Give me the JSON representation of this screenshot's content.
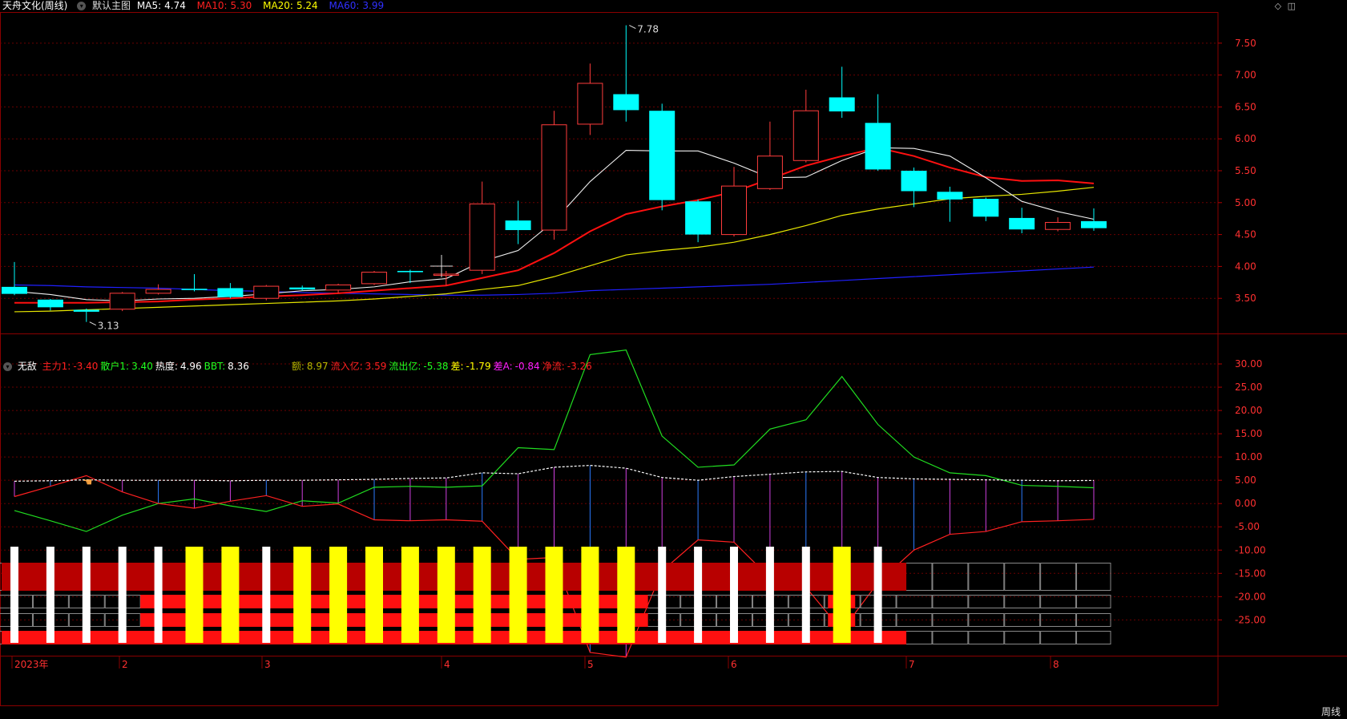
{
  "header": {
    "stock_name": "天舟文化(周线)",
    "main_chart_label": "默认主图",
    "indicators": [
      {
        "label": "MA5:",
        "value": "4.74",
        "color": "#ffffff"
      },
      {
        "label": "MA10:",
        "value": "5.30",
        "color": "#ff2020"
      },
      {
        "label": "MA20:",
        "value": "5.24",
        "color": "#ffff00"
      },
      {
        "label": "MA60:",
        "value": "3.99",
        "color": "#3030ff"
      }
    ]
  },
  "corner_icons": [
    "diamond-icon",
    "panel-icon"
  ],
  "sub_header": {
    "name": "无敌",
    "indicators": [
      {
        "label": "主力1:",
        "value": "-3.40",
        "color": "#ff2020"
      },
      {
        "label": "散户1:",
        "value": "3.40",
        "color": "#20ff20"
      },
      {
        "label": "热度:",
        "value": "4.96",
        "color": "#ffffff"
      },
      {
        "label": "BBT:",
        "value": "8.36",
        "color": "#20ff20"
      },
      {
        "label": "额:",
        "value": "8.97",
        "color": "#b8b800",
        "gap": true
      },
      {
        "label": "流入亿:",
        "value": "3.59",
        "color": "#ff2020"
      },
      {
        "label": "流出亿:",
        "value": "-5.38",
        "color": "#20ff20"
      },
      {
        "label": "差:",
        "value": "-1.79",
        "color": "#ffff00"
      },
      {
        "label": "差A:",
        "value": "-0.84",
        "color": "#ff20ff"
      },
      {
        "label": "净流:",
        "value": "-3.26",
        "color": "#ff2020"
      }
    ]
  },
  "x_axis_labels": [
    "2023年",
    "2",
    "3",
    "4",
    "5",
    "6",
    "7",
    "8"
  ],
  "period_label": "周线",
  "chart_data": [
    {
      "type": "candlestick",
      "title": "天舟文化(周线)",
      "y_ticks": [
        "7.50",
        "7.00",
        "6.50",
        "6.00",
        "5.50",
        "5.00",
        "4.50",
        "4.00",
        "3.50"
      ],
      "ylim": [
        3.0,
        7.95
      ],
      "annotations": [
        {
          "text": "7.78",
          "value": 7.78,
          "index": 17
        },
        {
          "text": "3.13",
          "value": 3.13,
          "index": 2
        }
      ],
      "candles": [
        {
          "o": 3.68,
          "c": 3.57,
          "h": 4.07,
          "l": 3.55
        },
        {
          "o": 3.48,
          "c": 3.36,
          "h": 3.49,
          "l": 3.31
        },
        {
          "o": 3.32,
          "c": 3.29,
          "h": 3.34,
          "l": 3.13
        },
        {
          "o": 3.33,
          "c": 3.58,
          "h": 3.6,
          "l": 3.3
        },
        {
          "o": 3.58,
          "c": 3.64,
          "h": 3.72,
          "l": 3.56
        },
        {
          "o": 3.65,
          "c": 3.63,
          "h": 3.88,
          "l": 3.61
        },
        {
          "o": 3.66,
          "c": 3.52,
          "h": 3.74,
          "l": 3.5
        },
        {
          "o": 3.5,
          "c": 3.69,
          "h": 3.71,
          "l": 3.47
        },
        {
          "o": 3.67,
          "c": 3.64,
          "h": 3.7,
          "l": 3.62
        },
        {
          "o": 3.63,
          "c": 3.71,
          "h": 3.73,
          "l": 3.58
        },
        {
          "o": 3.73,
          "c": 3.91,
          "h": 3.93,
          "l": 3.71
        },
        {
          "o": 3.93,
          "c": 3.91,
          "h": 3.95,
          "l": 3.74
        },
        {
          "o": 3.87,
          "c": 3.88,
          "h": 3.93,
          "l": 3.7
        },
        {
          "o": 3.94,
          "c": 4.98,
          "h": 5.33,
          "l": 3.88
        },
        {
          "o": 4.72,
          "c": 4.57,
          "h": 5.03,
          "l": 4.35
        },
        {
          "o": 4.57,
          "c": 6.22,
          "h": 6.44,
          "l": 4.42
        },
        {
          "o": 6.23,
          "c": 6.87,
          "h": 7.18,
          "l": 6.06
        },
        {
          "o": 6.7,
          "c": 6.45,
          "h": 7.78,
          "l": 6.27
        },
        {
          "o": 6.44,
          "c": 5.04,
          "h": 6.55,
          "l": 4.88
        },
        {
          "o": 5.02,
          "c": 4.5,
          "h": 5.05,
          "l": 4.38
        },
        {
          "o": 4.5,
          "c": 5.26,
          "h": 5.56,
          "l": 4.47
        },
        {
          "o": 5.22,
          "c": 5.73,
          "h": 6.27,
          "l": 5.2
        },
        {
          "o": 5.66,
          "c": 6.44,
          "h": 6.77,
          "l": 5.63
        },
        {
          "o": 6.65,
          "c": 6.43,
          "h": 7.13,
          "l": 6.33
        },
        {
          "o": 6.25,
          "c": 5.52,
          "h": 6.7,
          "l": 5.5
        },
        {
          "o": 5.5,
          "c": 5.18,
          "h": 5.55,
          "l": 4.93
        },
        {
          "o": 5.17,
          "c": 5.05,
          "h": 5.25,
          "l": 4.7
        },
        {
          "o": 5.06,
          "c": 4.78,
          "h": 5.08,
          "l": 4.71
        },
        {
          "o": 4.76,
          "c": 4.58,
          "h": 4.92,
          "l": 4.52
        },
        {
          "o": 4.58,
          "c": 4.69,
          "h": 4.77,
          "l": 4.55
        },
        {
          "o": 4.71,
          "c": 4.6,
          "h": 4.91,
          "l": 4.56
        }
      ],
      "ma5": [
        3.61,
        3.56,
        3.48,
        3.46,
        3.49,
        3.5,
        3.53,
        3.57,
        3.62,
        3.64,
        3.68,
        3.76,
        3.81,
        4.08,
        4.25,
        4.71,
        5.33,
        5.82,
        5.81,
        5.81,
        5.62,
        5.39,
        5.4,
        5.66,
        5.86,
        5.85,
        5.73,
        5.39,
        5.02,
        4.86,
        4.74
      ],
      "ma10": [
        3.43,
        3.43,
        3.43,
        3.44,
        3.45,
        3.48,
        3.5,
        3.53,
        3.55,
        3.58,
        3.62,
        3.66,
        3.7,
        3.82,
        3.94,
        4.21,
        4.55,
        4.82,
        4.94,
        5.04,
        5.17,
        5.37,
        5.58,
        5.73,
        5.86,
        5.73,
        5.55,
        5.4,
        5.34,
        5.35,
        5.3
      ],
      "ma20": [
        3.29,
        3.3,
        3.32,
        3.34,
        3.36,
        3.38,
        3.4,
        3.42,
        3.44,
        3.46,
        3.49,
        3.53,
        3.57,
        3.64,
        3.7,
        3.84,
        4.01,
        4.18,
        4.25,
        4.3,
        4.38,
        4.5,
        4.64,
        4.8,
        4.9,
        4.98,
        5.06,
        5.1,
        5.13,
        5.18,
        5.24
      ],
      "ma60": [
        3.71,
        3.7,
        3.68,
        3.67,
        3.66,
        3.64,
        3.62,
        3.61,
        3.59,
        3.58,
        3.57,
        3.56,
        3.55,
        3.55,
        3.56,
        3.58,
        3.62,
        3.64,
        3.66,
        3.68,
        3.7,
        3.72,
        3.75,
        3.78,
        3.81,
        3.84,
        3.87,
        3.9,
        3.93,
        3.96,
        3.99
      ]
    },
    {
      "type": "line",
      "title": "无敌",
      "y_ticks": [
        "30.00",
        "25.00",
        "20.00",
        "15.00",
        "10.00",
        "5.00",
        "0.00",
        "-5.00",
        "-10.00",
        "-15.00",
        "-20.00",
        "-25.00"
      ],
      "ylim": [
        -32.0,
        35.0
      ],
      "series": [
        {
          "name": "散户1",
          "color": "#20dd20",
          "values": [
            -1.5,
            -3.7,
            -6.0,
            -2.5,
            0.0,
            1.0,
            -0.5,
            -1.7,
            0.6,
            0.1,
            3.5,
            3.7,
            3.5,
            3.8,
            12.0,
            11.6,
            32.0,
            33.0,
            14.5,
            7.8,
            8.3,
            16.0,
            18.0,
            27.3,
            17.0,
            10.0,
            6.6,
            6.0,
            3.9,
            3.7,
            3.4
          ]
        },
        {
          "name": "主力1",
          "color": "#ff2020",
          "values": [
            1.5,
            3.7,
            6.0,
            2.5,
            0.0,
            -1.0,
            0.5,
            1.7,
            -0.6,
            -0.1,
            -3.5,
            -3.7,
            -3.5,
            -3.8,
            -12.0,
            -11.6,
            -32.0,
            -33.0,
            -14.5,
            -7.8,
            -8.3,
            -16.0,
            -18.0,
            -27.3,
            -17.0,
            -10.0,
            -6.6,
            -6.0,
            -3.9,
            -3.7,
            -3.4
          ]
        },
        {
          "name": "热度",
          "color": "#ffffff",
          "dashed": true,
          "values": [
            4.8,
            4.9,
            5.1,
            5.0,
            5.0,
            5.0,
            4.9,
            5.0,
            5.0,
            5.1,
            5.2,
            5.4,
            5.5,
            6.6,
            6.4,
            7.8,
            8.2,
            7.6,
            5.6,
            5.0,
            5.8,
            6.3,
            6.8,
            6.9,
            5.6,
            5.3,
            5.2,
            5.1,
            5.0,
            4.9,
            4.96
          ]
        }
      ],
      "signal_columns": [
        "white",
        "white",
        "white",
        "white",
        "white",
        "yellow",
        "yellow",
        "white",
        "yellow",
        "yellow",
        "yellow",
        "yellow",
        "yellow",
        "yellow",
        "yellow",
        "yellow",
        "yellow",
        "yellow",
        "white",
        "white",
        "white",
        "white",
        "white",
        "yellow",
        "white"
      ],
      "band_rows": [
        {
          "color": "#b80000",
          "start": 0,
          "end": 25
        },
        {
          "color": "#ff1010",
          "start": 4,
          "end": 18,
          "gap_start": 6,
          "gap_end": 7
        },
        {
          "color": "#ff1010",
          "start": 4,
          "end": 18,
          "gap_start": 6,
          "gap_end": 7
        },
        {
          "color": "#ff1010",
          "start": 0,
          "end": 25
        }
      ]
    }
  ]
}
